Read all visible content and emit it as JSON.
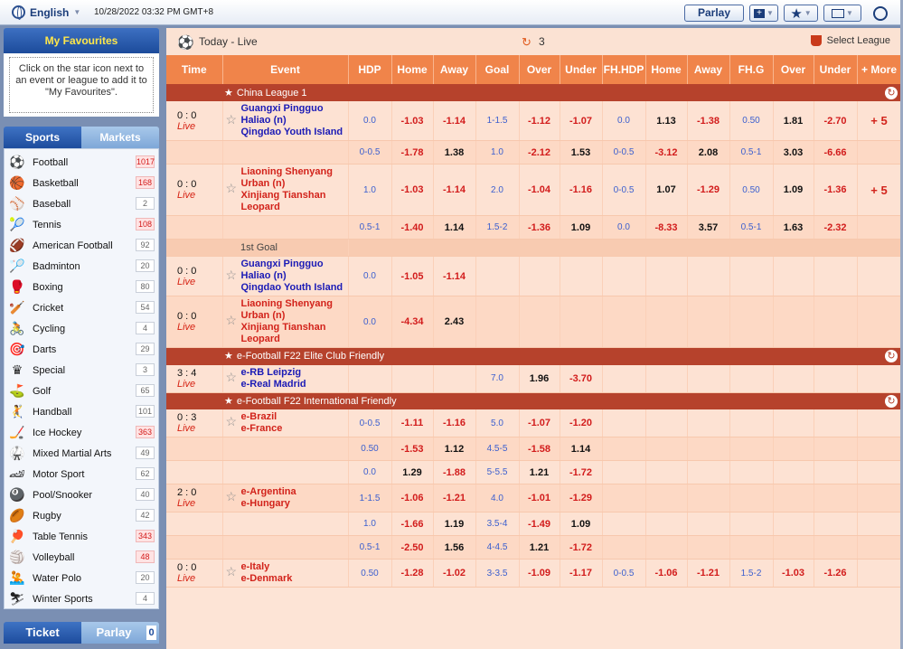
{
  "topbar": {
    "language": "English",
    "datetime": "10/28/2022 03:32 PM GMT+8",
    "parlay_label": "Parlay"
  },
  "favourites": {
    "title": "My Favourites",
    "hint": "Click on the star icon next to an event or league to add it to \"My Favourites\"."
  },
  "tabs": {
    "sports": "Sports",
    "markets": "Markets"
  },
  "sports": [
    {
      "icon": "football-icon",
      "glyph": "⚽",
      "name": "Football",
      "count": "1017",
      "hot": true
    },
    {
      "icon": "basketball-icon",
      "glyph": "🏀",
      "name": "Basketball",
      "count": "168",
      "hot": true
    },
    {
      "icon": "baseball-icon",
      "glyph": "⚾",
      "name": "Baseball",
      "count": "2",
      "hot": false
    },
    {
      "icon": "tennis-icon",
      "glyph": "🎾",
      "name": "Tennis",
      "count": "108",
      "hot": true
    },
    {
      "icon": "american-football-icon",
      "glyph": "🏈",
      "name": "American Football",
      "count": "92",
      "hot": false
    },
    {
      "icon": "badminton-icon",
      "glyph": "🏸",
      "name": "Badminton",
      "count": "20",
      "hot": false
    },
    {
      "icon": "boxing-icon",
      "glyph": "🥊",
      "name": "Boxing",
      "count": "80",
      "hot": false
    },
    {
      "icon": "cricket-icon",
      "glyph": "🏏",
      "name": "Cricket",
      "count": "54",
      "hot": false
    },
    {
      "icon": "cycling-icon",
      "glyph": "🚴",
      "name": "Cycling",
      "count": "4",
      "hot": false
    },
    {
      "icon": "darts-icon",
      "glyph": "🎯",
      "name": "Darts",
      "count": "29",
      "hot": false
    },
    {
      "icon": "special-icon",
      "glyph": "♛",
      "name": "Special",
      "count": "3",
      "hot": false
    },
    {
      "icon": "golf-icon",
      "glyph": "⛳",
      "name": "Golf",
      "count": "65",
      "hot": false
    },
    {
      "icon": "handball-icon",
      "glyph": "🤾",
      "name": "Handball",
      "count": "101",
      "hot": false
    },
    {
      "icon": "ice-hockey-icon",
      "glyph": "🏒",
      "name": "Ice Hockey",
      "count": "363",
      "hot": true
    },
    {
      "icon": "mma-icon",
      "glyph": "🥋",
      "name": "Mixed Martial Arts",
      "count": "49",
      "hot": false
    },
    {
      "icon": "motor-sport-icon",
      "glyph": "🏎",
      "name": "Motor Sport",
      "count": "62",
      "hot": false
    },
    {
      "icon": "pool-icon",
      "glyph": "🎱",
      "name": "Pool/Snooker",
      "count": "40",
      "hot": false
    },
    {
      "icon": "rugby-icon",
      "glyph": "🏉",
      "name": "Rugby",
      "count": "42",
      "hot": false
    },
    {
      "icon": "table-tennis-icon",
      "glyph": "🏓",
      "name": "Table Tennis",
      "count": "343",
      "hot": true
    },
    {
      "icon": "volleyball-icon",
      "glyph": "🏐",
      "name": "Volleyball",
      "count": "48",
      "hot": true
    },
    {
      "icon": "water-polo-icon",
      "glyph": "🤽",
      "name": "Water Polo",
      "count": "20",
      "hot": false
    },
    {
      "icon": "winter-sports-icon",
      "glyph": "⛷",
      "name": "Winter Sports",
      "count": "4",
      "hot": false
    }
  ],
  "bottom": {
    "ticket": "Ticket",
    "parlay": "Parlay",
    "parlay_count": "0"
  },
  "main": {
    "title": "Today - Live",
    "refresh_count": "3",
    "select_league": "Select League"
  },
  "columns": [
    "Time",
    "Event",
    "HDP",
    "Home",
    "Away",
    "Goal",
    "Over",
    "Under",
    "FH.HDP",
    "Home",
    "Away",
    "FH.G",
    "Over",
    "Under",
    "+ More"
  ],
  "rows": [
    {
      "type": "league",
      "name": "China League 1"
    },
    {
      "type": "match",
      "time": "0 : 0",
      "live": "Live",
      "teams": [
        "Guangxi Pingguo Haliao (n)",
        "Qingdao Youth Island"
      ],
      "fav_team": false,
      "cells": [
        "0.0",
        "-1.03",
        "-1.14",
        "1-1.5",
        "-1.12",
        "-1.07",
        "0.0",
        "1.13",
        "-1.38",
        "0.50",
        "1.81",
        "-2.70"
      ],
      "more": "+ 5"
    },
    {
      "type": "line",
      "cells": [
        "0-0.5",
        "-1.78",
        "1.38",
        "1.0",
        "-2.12",
        "1.53",
        "0-0.5",
        "-3.12",
        "2.08",
        "0.5-1",
        "3.03",
        "-6.66"
      ]
    },
    {
      "type": "match",
      "time": "0 : 0",
      "live": "Live",
      "teams": [
        "Liaoning Shenyang Urban (n)",
        "Xinjiang Tianshan Leopard"
      ],
      "fav_team": true,
      "cells": [
        "1.0",
        "-1.03",
        "-1.14",
        "2.0",
        "-1.04",
        "-1.16",
        "0-0.5",
        "1.07",
        "-1.29",
        "0.50",
        "1.09",
        "-1.36"
      ],
      "more": "+ 5"
    },
    {
      "type": "line",
      "cells": [
        "0.5-1",
        "-1.40",
        "1.14",
        "1.5-2",
        "-1.36",
        "1.09",
        "0.0",
        "-8.33",
        "3.57",
        "0.5-1",
        "1.63",
        "-2.32"
      ]
    },
    {
      "type": "sub",
      "name": "1st Goal"
    },
    {
      "type": "match",
      "time": "0 : 0",
      "live": "Live",
      "teams": [
        "Guangxi Pingguo Haliao (n)",
        "Qingdao Youth Island"
      ],
      "fav_team": false,
      "cells": [
        "0.0",
        "-1.05",
        "-1.14",
        "",
        "",
        "",
        "",
        "",
        "",
        "",
        "",
        ""
      ],
      "more": ""
    },
    {
      "type": "match",
      "time": "0 : 0",
      "live": "Live",
      "teams": [
        "Liaoning Shenyang Urban (n)",
        "Xinjiang Tianshan Leopard"
      ],
      "fav_team": true,
      "cells": [
        "0.0",
        "-4.34",
        "2.43",
        "",
        "",
        "",
        "",
        "",
        "",
        "",
        "",
        ""
      ],
      "more": ""
    },
    {
      "type": "league",
      "name": "e-Football F22 Elite Club Friendly"
    },
    {
      "type": "match",
      "time": "3 : 4",
      "live": "Live",
      "teams": [
        "e-RB Leipzig",
        "e-Real Madrid"
      ],
      "fav_team": false,
      "cells": [
        "",
        "",
        "",
        "7.0",
        "1.96",
        "-3.70",
        "",
        "",
        "",
        "",
        "",
        ""
      ],
      "more": ""
    },
    {
      "type": "league",
      "name": "e-Football F22 International Friendly"
    },
    {
      "type": "match",
      "time": "0 : 3",
      "live": "Live",
      "teams": [
        "e-Brazil",
        "e-France"
      ],
      "fav_team": true,
      "cells": [
        "0-0.5",
        "-1.11",
        "-1.16",
        "5.0",
        "-1.07",
        "-1.20",
        "",
        "",
        "",
        "",
        "",
        ""
      ],
      "more": ""
    },
    {
      "type": "line",
      "cells": [
        "0.50",
        "-1.53",
        "1.12",
        "4.5-5",
        "-1.58",
        "1.14",
        "",
        "",
        "",
        "",
        "",
        ""
      ]
    },
    {
      "type": "line",
      "cells": [
        "0.0",
        "1.29",
        "-1.88",
        "5-5.5",
        "1.21",
        "-1.72",
        "",
        "",
        "",
        "",
        "",
        ""
      ]
    },
    {
      "type": "match",
      "time": "2 : 0",
      "live": "Live",
      "teams": [
        "e-Argentina",
        "e-Hungary"
      ],
      "fav_team": true,
      "cells": [
        "1-1.5",
        "-1.06",
        "-1.21",
        "4.0",
        "-1.01",
        "-1.29",
        "",
        "",
        "",
        "",
        "",
        ""
      ],
      "more": ""
    },
    {
      "type": "line",
      "cells": [
        "1.0",
        "-1.66",
        "1.19",
        "3.5-4",
        "-1.49",
        "1.09",
        "",
        "",
        "",
        "",
        "",
        ""
      ]
    },
    {
      "type": "line",
      "cells": [
        "0.5-1",
        "-2.50",
        "1.56",
        "4-4.5",
        "1.21",
        "-1.72",
        "",
        "",
        "",
        "",
        "",
        ""
      ]
    },
    {
      "type": "match",
      "time": "0 : 0",
      "live": "Live",
      "teams": [
        "e-Italy",
        "e-Denmark"
      ],
      "fav_team": true,
      "cells": [
        "0.50",
        "-1.28",
        "-1.02",
        "3-3.5",
        "-1.09",
        "-1.17",
        "0-0.5",
        "-1.06",
        "-1.21",
        "1.5-2",
        "-1.03",
        "-1.26"
      ],
      "more": ""
    }
  ]
}
